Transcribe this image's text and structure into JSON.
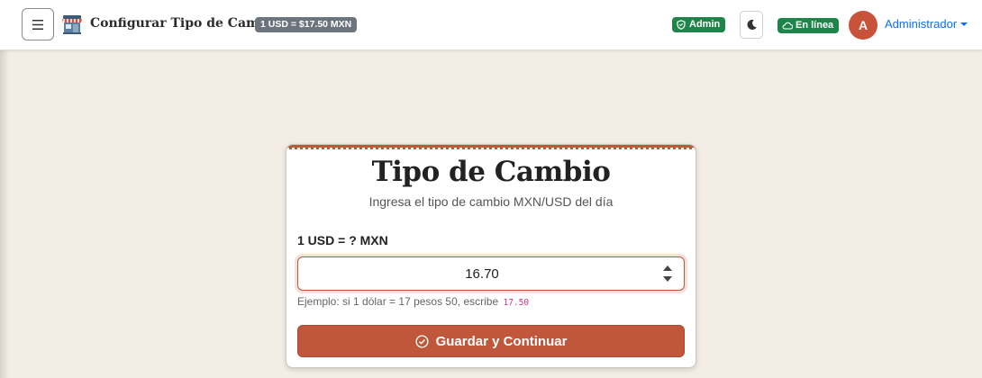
{
  "header": {
    "title": "Configurar Tipo de Cambio",
    "rate_badge": "1 USD = $17.50 MXN",
    "admin_badge": "Admin",
    "online_badge": "En línea",
    "avatar_initial": "A",
    "user_name": "Administrador"
  },
  "card": {
    "title": "Tipo de Cambio",
    "subtitle": "Ingresa el tipo de cambio MXN/USD del día",
    "field_label": "1 USD = ? MXN",
    "input_value": "16.70",
    "hint_text": "Ejemplo: si 1 dólar = 17 pesos 50, escribe",
    "hint_code": "17.50",
    "save_label": "Guardar y Continuar"
  },
  "colors": {
    "accent": "#c0573a",
    "success": "#1e8449",
    "secondary_badge": "#6c757d",
    "link": "#0d6efd",
    "background": "#f3ede6"
  },
  "icons": {
    "menu": "hamburger-icon",
    "logo": "storefront-icon",
    "admin": "shield-icon",
    "theme": "moon-icon",
    "online": "cloud-icon",
    "save": "check-circle-icon"
  }
}
